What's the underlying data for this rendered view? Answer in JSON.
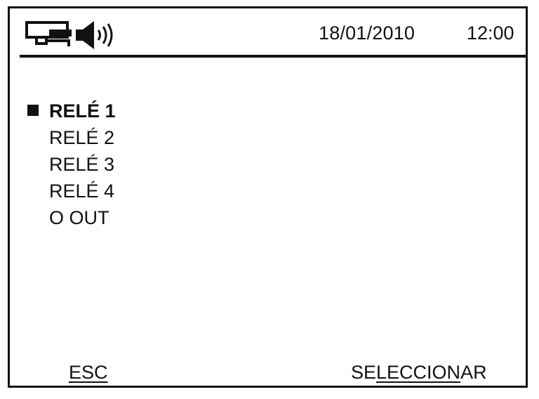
{
  "status_bar": {
    "icons": [
      "network-icon",
      "speaker-icon"
    ],
    "date": "18/01/2010",
    "time": "12:00"
  },
  "menu": {
    "items": [
      {
        "label": "RELÉ 1",
        "selected": true
      },
      {
        "label": "RELÉ 2",
        "selected": false
      },
      {
        "label": "RELÉ 3",
        "selected": false
      },
      {
        "label": "RELÉ 4",
        "selected": false
      },
      {
        "label": "O OUT",
        "selected": false
      }
    ]
  },
  "softkeys": {
    "left": {
      "label": "ESC"
    },
    "right": {
      "label": "SELECCIONAR",
      "prefix": "SE",
      "underlined": "LECCION",
      "suffix": "AR"
    }
  },
  "colors": {
    "foreground": "#111111",
    "background": "#ffffff"
  }
}
